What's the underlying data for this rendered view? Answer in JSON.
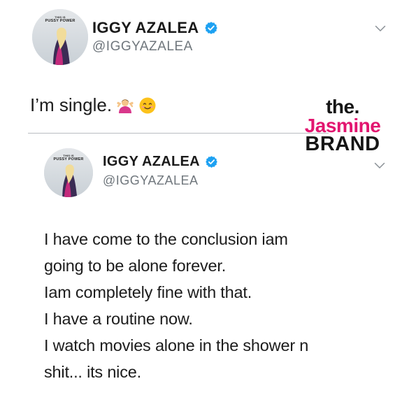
{
  "tweets": [
    {
      "avatar": {
        "caption_small": "THIS IS",
        "caption_big": "PUSSY POWER"
      },
      "display_name": "IGGY AZALEA",
      "handle": "@IGGYAZALEA",
      "verified": true,
      "text": "I’m single.",
      "emojis": [
        "person-shrugging-icon",
        "smiling-face-icon"
      ]
    },
    {
      "avatar": {
        "caption_small": "THIS IS",
        "caption_big": "PUSSY POWER"
      },
      "display_name": "IGGY AZALEA",
      "handle": "@IGGYAZALEA",
      "verified": true,
      "lines": [
        "I have come to the conclusion iam",
        "going to be alone forever.",
        "Iam completely fine with that.",
        "I have a routine now.",
        "I watch movies alone in the shower n",
        "shit... its nice."
      ]
    }
  ],
  "watermark": {
    "the": "the.",
    "jasmine": "Jasmine",
    "brand": "BRAND"
  },
  "colors": {
    "verified_blue": "#1da1f2",
    "handle_gray": "#6f767c",
    "watermark_pink": "#e2156f",
    "divider": "#b8bdc2"
  }
}
